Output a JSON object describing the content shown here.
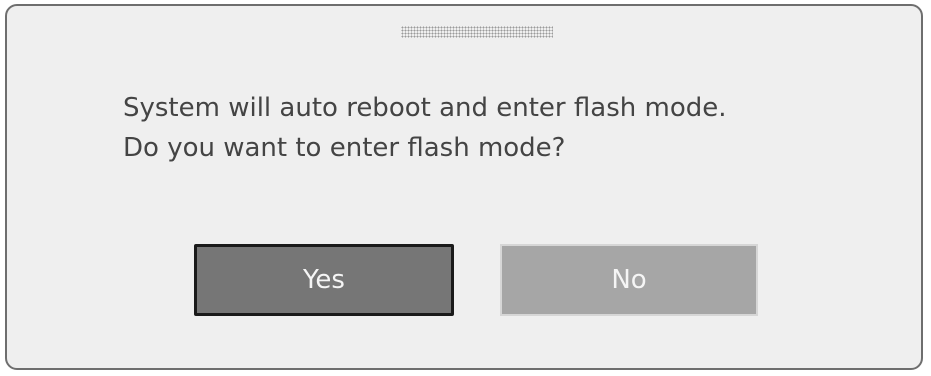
{
  "dialog": {
    "message_line1": "System will auto reboot and enter flash mode.",
    "message_line2": "Do you want to enter flash mode?",
    "yes_label": "Yes",
    "no_label": "No",
    "colors": {
      "background": "#efefef",
      "border": "#6e6e6e",
      "text": "#444444",
      "yes_button": "#767676",
      "no_button": "#a6a6a6"
    }
  }
}
